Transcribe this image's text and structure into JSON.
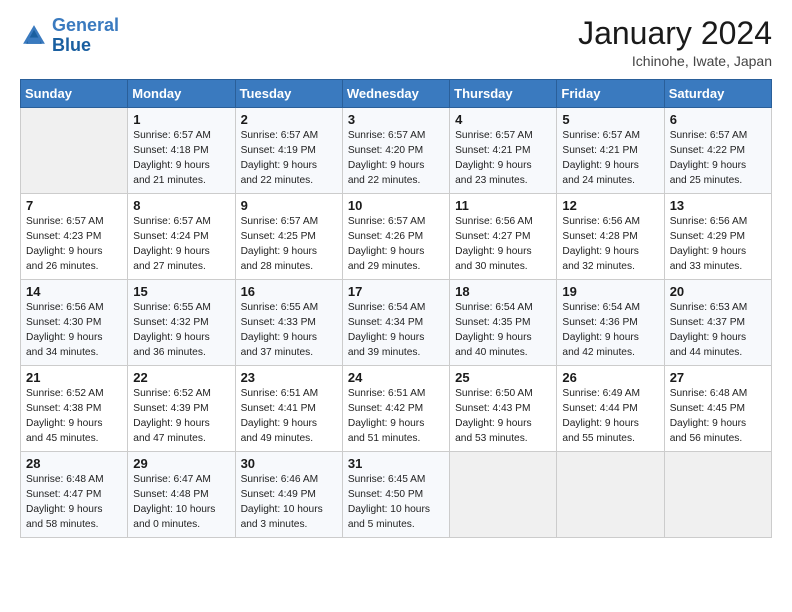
{
  "logo": {
    "line1": "General",
    "line2": "Blue"
  },
  "title": "January 2024",
  "location": "Ichinohe, Iwate, Japan",
  "days_of_week": [
    "Sunday",
    "Monday",
    "Tuesday",
    "Wednesday",
    "Thursday",
    "Friday",
    "Saturday"
  ],
  "weeks": [
    [
      {
        "day": "",
        "info": ""
      },
      {
        "day": "1",
        "info": "Sunrise: 6:57 AM\nSunset: 4:18 PM\nDaylight: 9 hours\nand 21 minutes."
      },
      {
        "day": "2",
        "info": "Sunrise: 6:57 AM\nSunset: 4:19 PM\nDaylight: 9 hours\nand 22 minutes."
      },
      {
        "day": "3",
        "info": "Sunrise: 6:57 AM\nSunset: 4:20 PM\nDaylight: 9 hours\nand 22 minutes."
      },
      {
        "day": "4",
        "info": "Sunrise: 6:57 AM\nSunset: 4:21 PM\nDaylight: 9 hours\nand 23 minutes."
      },
      {
        "day": "5",
        "info": "Sunrise: 6:57 AM\nSunset: 4:21 PM\nDaylight: 9 hours\nand 24 minutes."
      },
      {
        "day": "6",
        "info": "Sunrise: 6:57 AM\nSunset: 4:22 PM\nDaylight: 9 hours\nand 25 minutes."
      }
    ],
    [
      {
        "day": "7",
        "info": "Sunrise: 6:57 AM\nSunset: 4:23 PM\nDaylight: 9 hours\nand 26 minutes."
      },
      {
        "day": "8",
        "info": "Sunrise: 6:57 AM\nSunset: 4:24 PM\nDaylight: 9 hours\nand 27 minutes."
      },
      {
        "day": "9",
        "info": "Sunrise: 6:57 AM\nSunset: 4:25 PM\nDaylight: 9 hours\nand 28 minutes."
      },
      {
        "day": "10",
        "info": "Sunrise: 6:57 AM\nSunset: 4:26 PM\nDaylight: 9 hours\nand 29 minutes."
      },
      {
        "day": "11",
        "info": "Sunrise: 6:56 AM\nSunset: 4:27 PM\nDaylight: 9 hours\nand 30 minutes."
      },
      {
        "day": "12",
        "info": "Sunrise: 6:56 AM\nSunset: 4:28 PM\nDaylight: 9 hours\nand 32 minutes."
      },
      {
        "day": "13",
        "info": "Sunrise: 6:56 AM\nSunset: 4:29 PM\nDaylight: 9 hours\nand 33 minutes."
      }
    ],
    [
      {
        "day": "14",
        "info": "Sunrise: 6:56 AM\nSunset: 4:30 PM\nDaylight: 9 hours\nand 34 minutes."
      },
      {
        "day": "15",
        "info": "Sunrise: 6:55 AM\nSunset: 4:32 PM\nDaylight: 9 hours\nand 36 minutes."
      },
      {
        "day": "16",
        "info": "Sunrise: 6:55 AM\nSunset: 4:33 PM\nDaylight: 9 hours\nand 37 minutes."
      },
      {
        "day": "17",
        "info": "Sunrise: 6:54 AM\nSunset: 4:34 PM\nDaylight: 9 hours\nand 39 minutes."
      },
      {
        "day": "18",
        "info": "Sunrise: 6:54 AM\nSunset: 4:35 PM\nDaylight: 9 hours\nand 40 minutes."
      },
      {
        "day": "19",
        "info": "Sunrise: 6:54 AM\nSunset: 4:36 PM\nDaylight: 9 hours\nand 42 minutes."
      },
      {
        "day": "20",
        "info": "Sunrise: 6:53 AM\nSunset: 4:37 PM\nDaylight: 9 hours\nand 44 minutes."
      }
    ],
    [
      {
        "day": "21",
        "info": "Sunrise: 6:52 AM\nSunset: 4:38 PM\nDaylight: 9 hours\nand 45 minutes."
      },
      {
        "day": "22",
        "info": "Sunrise: 6:52 AM\nSunset: 4:39 PM\nDaylight: 9 hours\nand 47 minutes."
      },
      {
        "day": "23",
        "info": "Sunrise: 6:51 AM\nSunset: 4:41 PM\nDaylight: 9 hours\nand 49 minutes."
      },
      {
        "day": "24",
        "info": "Sunrise: 6:51 AM\nSunset: 4:42 PM\nDaylight: 9 hours\nand 51 minutes."
      },
      {
        "day": "25",
        "info": "Sunrise: 6:50 AM\nSunset: 4:43 PM\nDaylight: 9 hours\nand 53 minutes."
      },
      {
        "day": "26",
        "info": "Sunrise: 6:49 AM\nSunset: 4:44 PM\nDaylight: 9 hours\nand 55 minutes."
      },
      {
        "day": "27",
        "info": "Sunrise: 6:48 AM\nSunset: 4:45 PM\nDaylight: 9 hours\nand 56 minutes."
      }
    ],
    [
      {
        "day": "28",
        "info": "Sunrise: 6:48 AM\nSunset: 4:47 PM\nDaylight: 9 hours\nand 58 minutes."
      },
      {
        "day": "29",
        "info": "Sunrise: 6:47 AM\nSunset: 4:48 PM\nDaylight: 10 hours\nand 0 minutes."
      },
      {
        "day": "30",
        "info": "Sunrise: 6:46 AM\nSunset: 4:49 PM\nDaylight: 10 hours\nand 3 minutes."
      },
      {
        "day": "31",
        "info": "Sunrise: 6:45 AM\nSunset: 4:50 PM\nDaylight: 10 hours\nand 5 minutes."
      },
      {
        "day": "",
        "info": ""
      },
      {
        "day": "",
        "info": ""
      },
      {
        "day": "",
        "info": ""
      }
    ]
  ]
}
